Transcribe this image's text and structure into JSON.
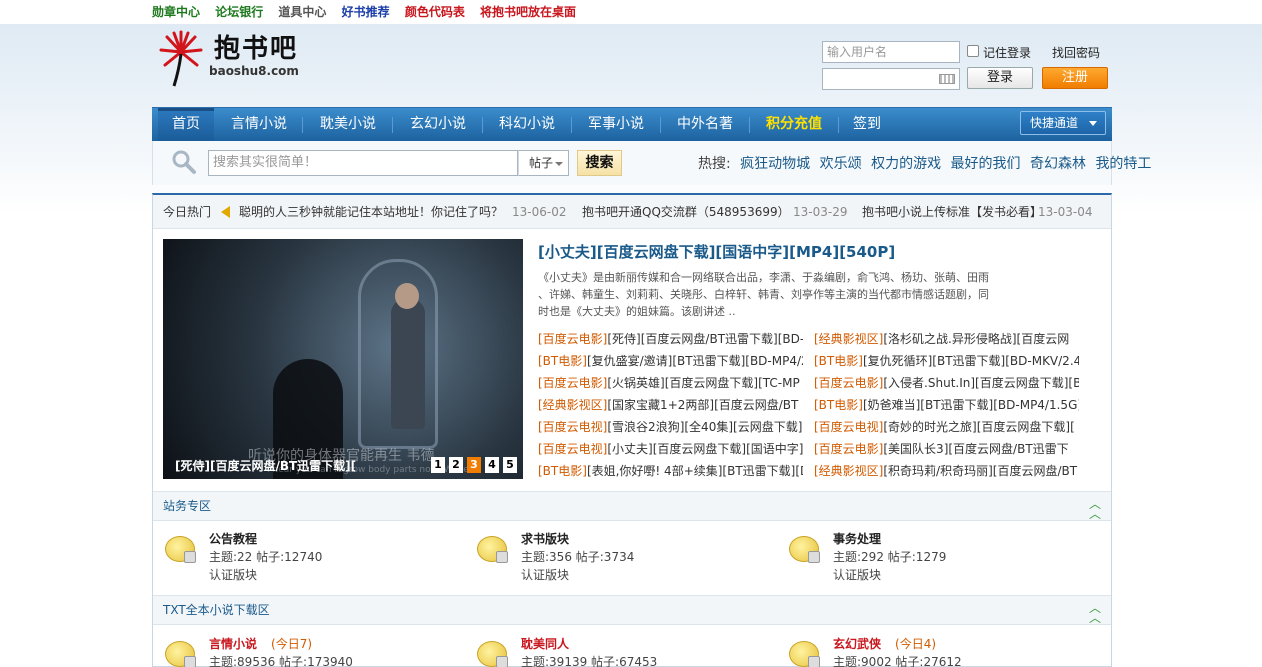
{
  "top_links": [
    {
      "label": "勋章中心",
      "color": "#1f7a1f"
    },
    {
      "label": "论坛银行",
      "color": "#1f7a1f"
    },
    {
      "label": "道具中心",
      "color": "#555555"
    },
    {
      "label": "好书推荐",
      "color": "#1a3ea8"
    },
    {
      "label": "颜色代码表",
      "color": "#c8171e"
    },
    {
      "label": "将抱书吧放在桌面",
      "color": "#c8171e"
    }
  ],
  "logo": {
    "name": "抱书吧",
    "domain": "baoshu8.com"
  },
  "login": {
    "username_placeholder": "输入用户名",
    "remember_label": "记住登录",
    "forgot_label": "找回密码",
    "login_label": "登录",
    "register_label": "注册"
  },
  "nav": {
    "items": [
      "首页",
      "言情小说",
      "耽美小说",
      "玄幻小说",
      "科幻小说",
      "军事小说",
      "中外名著",
      "积分充值",
      "签到"
    ],
    "quick_label": "快捷通道"
  },
  "search": {
    "placeholder": "搜索其实很简单！",
    "scope": "帖子",
    "button": "搜索",
    "hot_label": "热搜:",
    "hot_keywords": [
      "疯狂动物城",
      "欢乐颂",
      "权力的游戏",
      "最好的我们",
      "奇幻森林",
      "我的特工"
    ]
  },
  "ticker": {
    "label": "今日热门",
    "items": [
      {
        "text": "聪明的人三秒钟就能记住本站地址！你记住了吗？",
        "date": "13-06-02"
      },
      {
        "text": "抱书吧开通QQ交流群（548953699）",
        "date": "13-03-29"
      },
      {
        "text": "抱书吧小说上传标准【发书必看】",
        "date": "13-03-04"
      }
    ]
  },
  "slideshow": {
    "caption": "[死侍][百度云网盘/BT迅雷下载][",
    "subtitle": "听说你的身体器官能再生 韦德",
    "subtitle_en": "I hear you can regrow body parts now, Wade.",
    "pages": [
      "1",
      "2",
      "3",
      "4",
      "5"
    ],
    "active_page": 3
  },
  "featured": {
    "title": "[小丈夫][百度云网盘下载][国语中字][MP4][540P]",
    "desc_lines": [
      "《小丈夫》是由新丽传媒和合一网络联合出品，李潇、于淼编剧，俞飞鸿、杨玏、张萌、田雨",
      "、许娣、韩童生、刘莉莉、关晓彤、白梓轩、韩青、刘亭作等主演的当代都市情感话题剧，同",
      "时也是《大丈夫》的姐妹篇。该剧讲述 .."
    ]
  },
  "links_left": [
    {
      "tag": "[百度云电影]",
      "text": "[死侍][百度云网盘/BT迅雷下载][BD-"
    },
    {
      "tag": "[BT电影]",
      "text": "[复仇盛宴/邀请][BT迅雷下载][BD-MP4/2."
    },
    {
      "tag": "[百度云电影]",
      "text": "[火锅英雄][百度云网盘下载][TC-MP"
    },
    {
      "tag": "[经典影视区]",
      "text": "[国家宝藏1+2两部][百度云网盘/BT"
    },
    {
      "tag": "[百度云电视]",
      "text": "[雪浪谷2浪狗][全40集][云网盘下载]["
    },
    {
      "tag": "[百度云电视]",
      "text": "[小丈夫][百度云网盘下载][国语中字]"
    },
    {
      "tag": "[BT电影]",
      "text": "[表姐,你好嘢! 4部+续集][BT迅雷下载][D"
    }
  ],
  "links_right": [
    {
      "tag": "[经典影视区]",
      "text": "[洛杉矶之战.异形侵略战][百度云网"
    },
    {
      "tag": "[BT电影]",
      "text": "[复仇死循环][BT迅雷下载][BD-MKV/2.45"
    },
    {
      "tag": "[百度云电影]",
      "text": "[入侵者.Shut.In][百度云网盘下载][BD-"
    },
    {
      "tag": "[BT电影]",
      "text": "[奶爸难当][BT迅雷下载][BD-MP4/1.5G]["
    },
    {
      "tag": "[百度云电视]",
      "text": "[奇妙的时光之旅][百度云网盘下载]["
    },
    {
      "tag": "[百度云电影]",
      "text": "[美国队长3][百度云网盘/BT迅雷下"
    },
    {
      "tag": "[经典影视区]",
      "text": "[积奇玛莉/积奇玛丽][百度云网盘/BT"
    }
  ],
  "sections": [
    {
      "title": "站务专区",
      "forums": [
        {
          "name": "公告教程",
          "stat": "主题:22   帖子:12740",
          "note": "认证版块"
        },
        {
          "name": "求书版块",
          "stat": "主题:356   帖子:3734",
          "note": "认证版块"
        },
        {
          "name": "事务处理",
          "stat": "主题:292   帖子:1279",
          "note": "认证版块"
        }
      ]
    },
    {
      "title": "TXT全本小说下载区",
      "forums": [
        {
          "name": "言情小说",
          "today": "(今日7)",
          "stat": "主题:89536   帖子:173940"
        },
        {
          "name": "耽美同人",
          "today": "",
          "stat": "主题:39139   帖子:67453"
        },
        {
          "name": "玄幻武侠",
          "today": "(今日4)",
          "stat": "主题:9002   帖子:27612"
        }
      ]
    }
  ],
  "colors": {
    "nav_blue": "#1d62a0",
    "accent_orange": "#f07d00",
    "link_blue": "#1a5a8a",
    "tag_orange": "#d25a00",
    "forum_red": "#c8171e"
  }
}
